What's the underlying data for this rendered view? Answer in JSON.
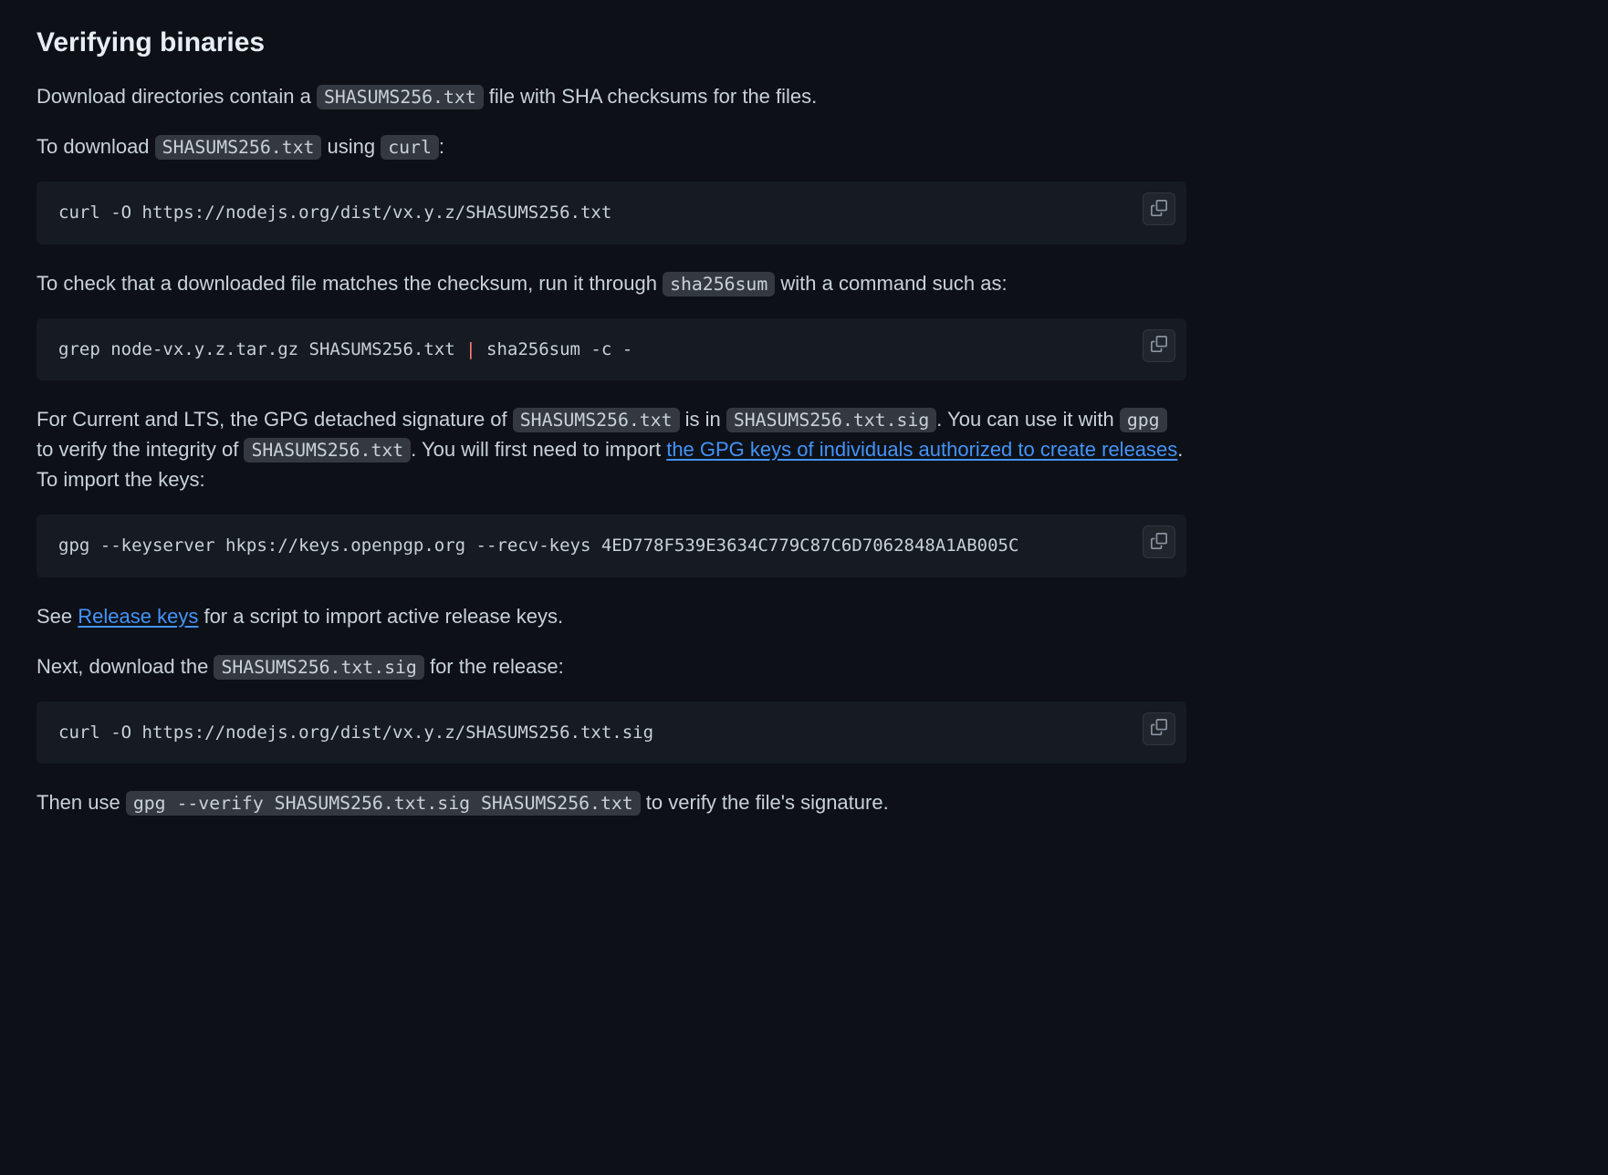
{
  "heading": "Verifying binaries",
  "p1": {
    "t1": "Download directories contain a ",
    "c1": "SHASUMS256.txt",
    "t2": " file with SHA checksums for the files."
  },
  "p2": {
    "t1": "To download ",
    "c1": "SHASUMS256.txt",
    "t2": " using ",
    "c2": "curl",
    "t3": ":"
  },
  "code1": "curl -O https://nodejs.org/dist/vx.y.z/SHASUMS256.txt",
  "p3": {
    "t1": "To check that a downloaded file matches the checksum, run it through ",
    "c1": "sha256sum",
    "t2": " with a command such as:"
  },
  "code2": {
    "left": "grep node-vx.y.z.tar.gz SHASUMS256.txt ",
    "pipe": "|",
    "right": " sha256sum -c -"
  },
  "p4": {
    "t1": "For Current and LTS, the GPG detached signature of ",
    "c1": "SHASUMS256.txt",
    "t2": " is in ",
    "c2": "SHASUMS256.txt.sig",
    "t3": ". You can use it with ",
    "c3": "gpg",
    "t4": " to verify the integrity of ",
    "c4": "SHASUMS256.txt",
    "t5": ". You will first need to import ",
    "link": "the GPG keys of individuals authorized to create releases",
    "t6": ". To import the keys:"
  },
  "code3": "gpg --keyserver hkps://keys.openpgp.org --recv-keys 4ED778F539E3634C779C87C6D7062848A1AB005C",
  "p5": {
    "t1": "See ",
    "link": "Release keys",
    "t2": " for a script to import active release keys."
  },
  "p6": {
    "t1": "Next, download the ",
    "c1": "SHASUMS256.txt.sig",
    "t2": " for the release:"
  },
  "code4": "curl -O https://nodejs.org/dist/vx.y.z/SHASUMS256.txt.sig",
  "p7": {
    "t1": "Then use ",
    "c1": "gpg --verify SHASUMS256.txt.sig SHASUMS256.txt",
    "t2": " to verify the file's signature."
  },
  "copy_label": "Copy"
}
